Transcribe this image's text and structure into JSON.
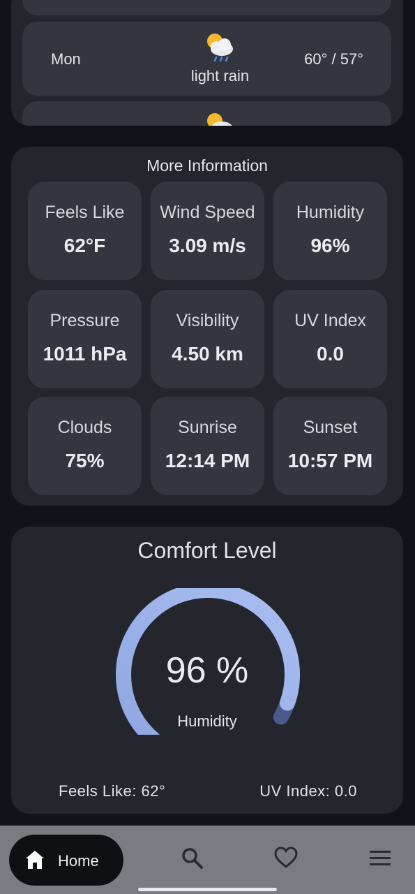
{
  "forecast": {
    "day": "Mon",
    "description": "light rain",
    "temperature": "60° / 57°",
    "icon": "cloud-sun-rain-icon"
  },
  "more_info": {
    "title": "More Information",
    "tiles": [
      {
        "label": "Feels Like",
        "value": "62°F"
      },
      {
        "label": "Wind Speed",
        "value": "3.09 m/s"
      },
      {
        "label": "Humidity",
        "value": "96%"
      },
      {
        "label": "Pressure",
        "value": "1011 hPa"
      },
      {
        "label": "Visibility",
        "value": "4.50 km"
      },
      {
        "label": "UV Index",
        "value": "0.0"
      },
      {
        "label": "Clouds",
        "value": "75%"
      },
      {
        "label": "Sunrise",
        "value": "12:14 PM"
      },
      {
        "label": "Sunset",
        "value": "10:57 PM"
      }
    ]
  },
  "comfort": {
    "title": "Comfort Level",
    "value_text": "96 %",
    "value": 96,
    "label": "Humidity",
    "feels_like": "Feels Like: 62°",
    "uv_index": "UV Index: 0.0",
    "gauge_colors": {
      "track": "#4a5a8a",
      "fill_start": "#8fa6e0",
      "fill_end": "#a9bff2"
    }
  },
  "nav": {
    "home_label": "Home",
    "items": [
      "home-icon",
      "search-icon",
      "heart-icon",
      "menu-icon"
    ]
  }
}
